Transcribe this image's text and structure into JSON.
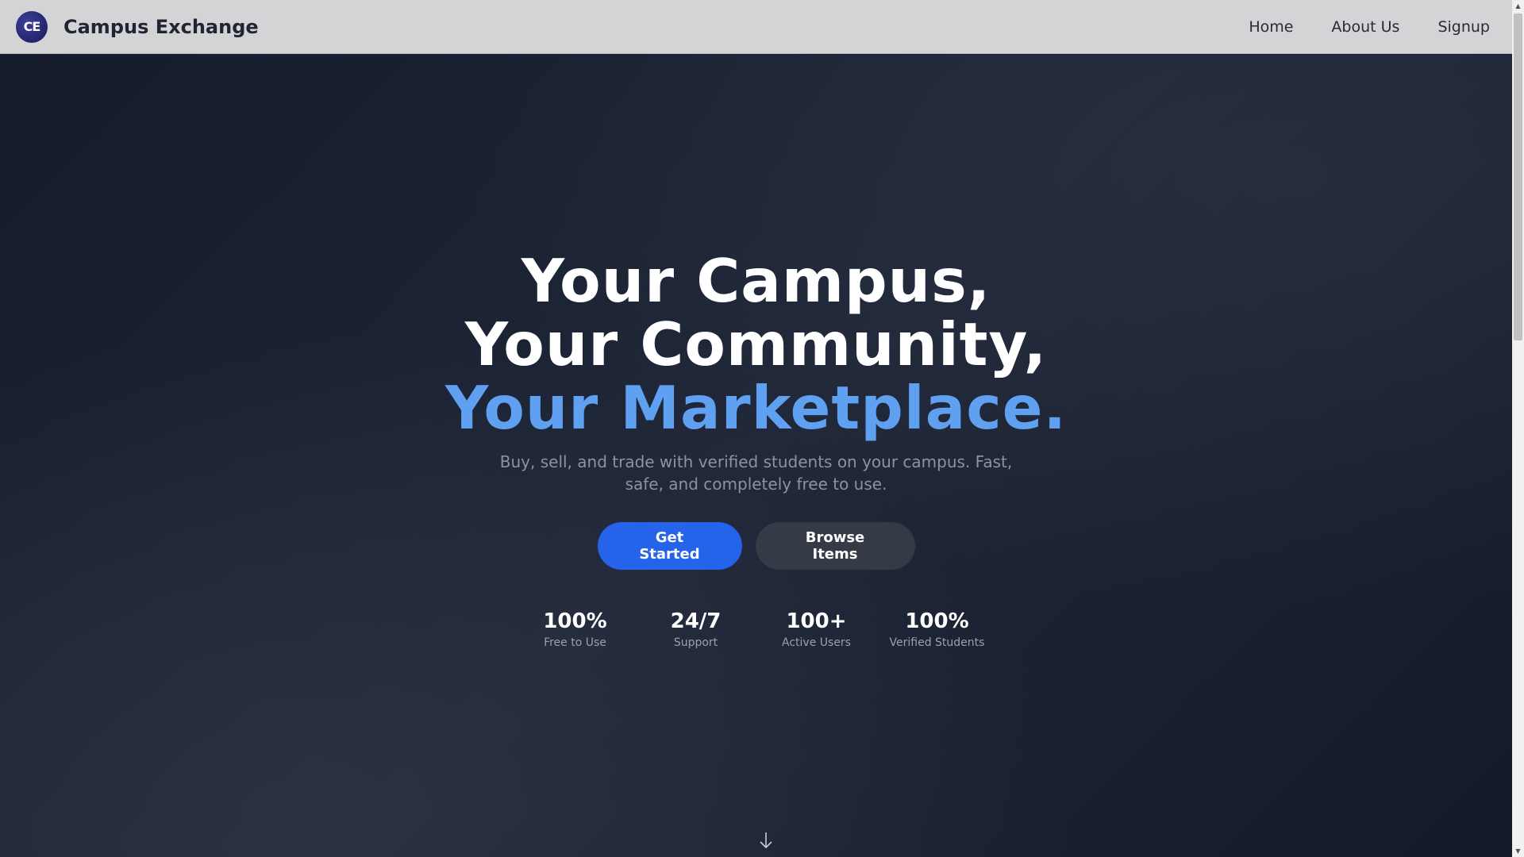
{
  "navbar": {
    "logo_text": "CE",
    "brand_name": "Campus Exchange",
    "links": [
      {
        "label": "Home"
      },
      {
        "label": "About Us"
      },
      {
        "label": "Signup"
      }
    ]
  },
  "hero": {
    "headline_line1": "Your Campus,",
    "headline_line2": "Your Community,",
    "headline_line3": "Your Marketplace.",
    "subtitle": "Buy, sell, and trade with verified students on your campus. Fast, safe, and completely free to use.",
    "primary_button": "Get Started",
    "secondary_button": "Browse Items",
    "stats": [
      {
        "value": "100%",
        "label": "Free to Use"
      },
      {
        "value": "24/7",
        "label": "Support"
      },
      {
        "value": "100+",
        "label": "Active Users"
      },
      {
        "value": "100%",
        "label": "Verified Students"
      }
    ],
    "scroll_icon": "arrow-down-icon"
  },
  "colors": {
    "accent": "#60a0f0",
    "primary_button": "#2563eb",
    "secondary_button": "#343a46",
    "navbar_bg": "#d4d4d6",
    "hero_bg": "#1a2233"
  }
}
